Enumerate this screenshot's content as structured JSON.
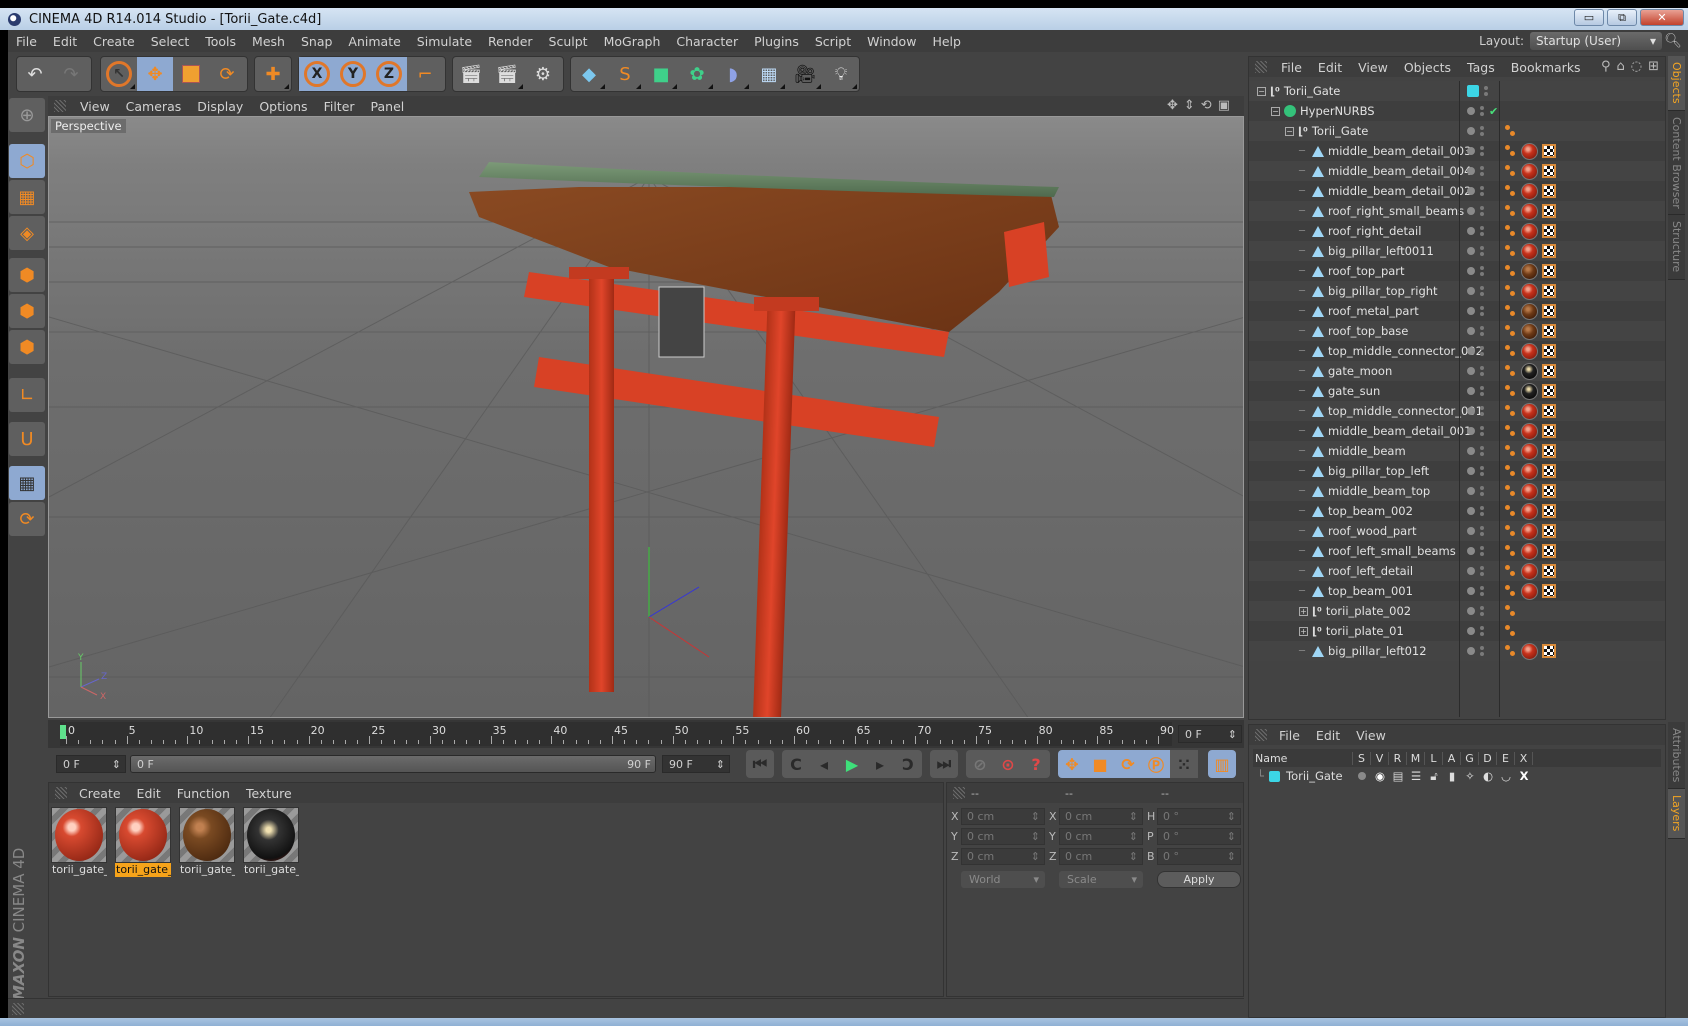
{
  "window": {
    "title": "CINEMA 4D R14.014 Studio - [Torii_Gate.c4d]",
    "buttons": {
      "minimize": "▭",
      "restore": "⧉",
      "close": "✕"
    }
  },
  "menubar": {
    "items": [
      "File",
      "Edit",
      "Create",
      "Select",
      "Tools",
      "Mesh",
      "Snap",
      "Animate",
      "Simulate",
      "Render",
      "Sculpt",
      "MoGraph",
      "Character",
      "Plugins",
      "Script",
      "Window",
      "Help"
    ],
    "layout_label": "Layout:",
    "layout_value": "Startup (User)"
  },
  "toolbar": {
    "groups": [
      {
        "name": "history",
        "items": [
          "undo-icon",
          "redo-icon"
        ]
      },
      {
        "name": "tools",
        "items": [
          "live-selection-icon",
          "move-icon",
          "scale-icon",
          "rotate-icon"
        ]
      },
      {
        "name": "recent",
        "items": [
          "add-object-icon"
        ]
      },
      {
        "name": "axis-lock",
        "items": [
          "x-axis-icon",
          "y-axis-icon",
          "z-axis-icon",
          "coordinate-system-icon"
        ]
      },
      {
        "name": "render",
        "items": [
          "render-view-icon",
          "render-picture-viewer-icon",
          "render-settings-icon"
        ]
      },
      {
        "name": "create",
        "items": [
          "cube-icon",
          "spline-pen-icon",
          "nurbs-icon",
          "array-icon",
          "deformer-icon",
          "floor-icon",
          "camera-icon",
          "light-icon"
        ]
      }
    ],
    "axis_labels": [
      "X",
      "Y",
      "Z"
    ]
  },
  "left_tools": [
    "make-editable-icon",
    "model-mode-icon",
    "texture-mode-icon",
    "workplane-mode-icon",
    "points-mode-icon",
    "edges-mode-icon",
    "polygons-mode-icon",
    "axis-mode-icon",
    "snap-magnet-icon",
    "locked-workplane-icon",
    "workplane-rotate-icon"
  ],
  "viewport": {
    "menu": [
      "View",
      "Cameras",
      "Display",
      "Options",
      "Filter",
      "Panel"
    ],
    "camera_label": "Perspective",
    "nav_icons": [
      "pan-icon",
      "dolly-icon",
      "orbit-icon",
      "maximize-icon"
    ],
    "axis_labels": {
      "y": "Y",
      "x": "X",
      "z": "Z"
    }
  },
  "timeline": {
    "ticks": [
      "0",
      "5",
      "10",
      "15",
      "20",
      "25",
      "30",
      "35",
      "40",
      "45",
      "50",
      "55",
      "60",
      "65",
      "70",
      "75",
      "80",
      "85",
      "90"
    ],
    "current_frame_field": "0 F",
    "start_field": "0 F",
    "range_start": "0 F",
    "range_end": "90 F",
    "end_field": "90 F"
  },
  "materials": {
    "menu": [
      "Create",
      "Edit",
      "Function",
      "Texture"
    ],
    "items": [
      {
        "label": "torii_gate_",
        "selected": false,
        "type": "red-lacquer"
      },
      {
        "label": "torii_gate_",
        "selected": true,
        "type": "red-lacquer"
      },
      {
        "label": "torii_gate_",
        "selected": false,
        "type": "wood"
      },
      {
        "label": "torii_gate_",
        "selected": false,
        "type": "dark-metal"
      }
    ]
  },
  "coordinates": {
    "headers": [
      "--",
      "--",
      "--"
    ],
    "position": [
      {
        "axis": "X",
        "value": "0 cm"
      },
      {
        "axis": "Y",
        "value": "0 cm"
      },
      {
        "axis": "Z",
        "value": "0 cm"
      }
    ],
    "size": [
      {
        "axis": "X",
        "value": "0 cm"
      },
      {
        "axis": "Y",
        "value": "0 cm"
      },
      {
        "axis": "Z",
        "value": "0 cm"
      }
    ],
    "rotation": [
      {
        "axis": "H",
        "value": "0 °"
      },
      {
        "axis": "P",
        "value": "0 °"
      },
      {
        "axis": "B",
        "value": "0 °"
      }
    ],
    "space_select": "World",
    "mode_select": "Scale",
    "apply_label": "Apply"
  },
  "brand": {
    "company": "MAXON",
    "product": "CINEMA 4D"
  },
  "objects_panel": {
    "menu": [
      "File",
      "Edit",
      "View",
      "Objects",
      "Tags",
      "Bookmarks"
    ],
    "tree": [
      {
        "name": "Torii_Gate",
        "type": "null",
        "depth": 0,
        "expander": "−",
        "layer": true
      },
      {
        "name": "HyperNURBS",
        "type": "nurbs",
        "depth": 1,
        "expander": "−",
        "enabled": true
      },
      {
        "name": "Torii_Gate",
        "type": "null",
        "depth": 2,
        "expander": "−",
        "phong": true
      },
      {
        "name": "middle_beam_detail_003",
        "type": "poly",
        "depth": 3,
        "tags": [
          "phong",
          "material-red",
          "uvw"
        ]
      },
      {
        "name": "middle_beam_detail_004",
        "type": "poly",
        "depth": 3,
        "tags": [
          "phong",
          "material-red",
          "uvw"
        ]
      },
      {
        "name": "middle_beam_detail_002",
        "type": "poly",
        "depth": 3,
        "tags": [
          "phong",
          "material-red",
          "uvw"
        ]
      },
      {
        "name": "roof_right_small_beams",
        "type": "poly",
        "depth": 3,
        "tags": [
          "phong",
          "material-red",
          "uvw"
        ]
      },
      {
        "name": "roof_right_detail",
        "type": "poly",
        "depth": 3,
        "tags": [
          "phong",
          "material-red",
          "uvw"
        ]
      },
      {
        "name": "big_pillar_left0011",
        "type": "poly",
        "depth": 3,
        "tags": [
          "phong",
          "material-red",
          "uvw"
        ]
      },
      {
        "name": "roof_top_part",
        "type": "poly",
        "depth": 3,
        "tags": [
          "phong",
          "material-wood",
          "uvw"
        ]
      },
      {
        "name": "big_pillar_top_right",
        "type": "poly",
        "depth": 3,
        "tags": [
          "phong",
          "material-red",
          "uvw"
        ]
      },
      {
        "name": "roof_metal_part",
        "type": "poly",
        "depth": 3,
        "tags": [
          "phong",
          "material-wood",
          "uvw"
        ]
      },
      {
        "name": "roof_top_base",
        "type": "poly",
        "depth": 3,
        "tags": [
          "phong",
          "material-wood",
          "uvw"
        ]
      },
      {
        "name": "top_middle_connector_002",
        "type": "poly",
        "depth": 3,
        "tags": [
          "phong",
          "material-red",
          "uvw"
        ]
      },
      {
        "name": "gate_moon",
        "type": "poly",
        "depth": 3,
        "tags": [
          "phong",
          "material-dark",
          "uvw"
        ]
      },
      {
        "name": "gate_sun",
        "type": "poly",
        "depth": 3,
        "tags": [
          "phong",
          "material-dark",
          "uvw"
        ]
      },
      {
        "name": "top_middle_connector_001",
        "type": "poly",
        "depth": 3,
        "tags": [
          "phong",
          "material-red",
          "uvw"
        ]
      },
      {
        "name": "middle_beam_detail_001",
        "type": "poly",
        "depth": 3,
        "tags": [
          "phong",
          "material-red",
          "uvw"
        ]
      },
      {
        "name": "middle_beam",
        "type": "poly",
        "depth": 3,
        "tags": [
          "phong",
          "material-red",
          "uvw"
        ]
      },
      {
        "name": "big_pillar_top_left",
        "type": "poly",
        "depth": 3,
        "tags": [
          "phong",
          "material-red",
          "uvw"
        ]
      },
      {
        "name": "middle_beam_top",
        "type": "poly",
        "depth": 3,
        "tags": [
          "phong",
          "material-red",
          "uvw"
        ]
      },
      {
        "name": "top_beam_002",
        "type": "poly",
        "depth": 3,
        "tags": [
          "phong",
          "material-red",
          "uvw"
        ]
      },
      {
        "name": "roof_wood_part",
        "type": "poly",
        "depth": 3,
        "tags": [
          "phong",
          "material-red",
          "uvw"
        ]
      },
      {
        "name": "roof_left_small_beams",
        "type": "poly",
        "depth": 3,
        "tags": [
          "phong",
          "material-red",
          "uvw"
        ]
      },
      {
        "name": "roof_left_detail",
        "type": "poly",
        "depth": 3,
        "tags": [
          "phong",
          "material-red",
          "uvw"
        ]
      },
      {
        "name": "top_beam_001",
        "type": "poly",
        "depth": 3,
        "tags": [
          "phong",
          "material-red",
          "uvw"
        ]
      },
      {
        "name": "torii_plate_002",
        "type": "null",
        "depth": 3,
        "expander": "+",
        "tags": [
          "phong"
        ]
      },
      {
        "name": "torii_plate_01",
        "type": "null",
        "depth": 3,
        "expander": "+",
        "tags": [
          "phong"
        ]
      },
      {
        "name": "big_pillar_left012",
        "type": "poly",
        "depth": 3,
        "tags": [
          "phong",
          "material-red",
          "uvw"
        ]
      }
    ]
  },
  "side_tabs_top": [
    {
      "label": "Objects",
      "active": true
    },
    {
      "label": "Content Browser",
      "active": false
    },
    {
      "label": "Structure",
      "active": false
    }
  ],
  "side_tabs_bottom": [
    {
      "label": "Attributes",
      "active": false
    },
    {
      "label": "Layers",
      "active": true
    }
  ],
  "layers_panel": {
    "menu": [
      "File",
      "Edit",
      "View"
    ],
    "columns": [
      "Name",
      "S",
      "V",
      "R",
      "M",
      "L",
      "A",
      "G",
      "D",
      "E",
      "X"
    ],
    "rows": [
      {
        "name": "Torii_Gate",
        "color": "#3cd6e6"
      }
    ]
  },
  "colors": {
    "accent": "#f5a623",
    "selection": "#8ea9d1",
    "play": "#3ee07a",
    "layer": "#3cd6e6"
  }
}
